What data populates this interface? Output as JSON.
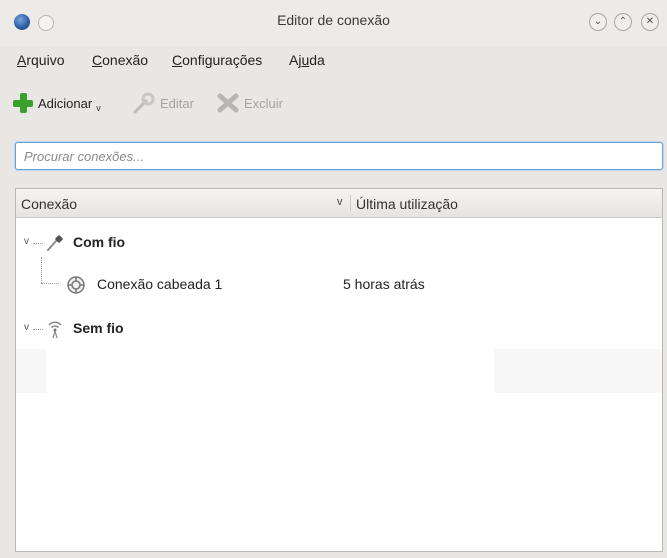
{
  "window": {
    "title": "Editor de conexão"
  },
  "menu": [
    {
      "pre": "",
      "u": "A",
      "post": "rquivo"
    },
    {
      "pre": "",
      "u": "C",
      "post": "onexão"
    },
    {
      "pre": "",
      "u": "C",
      "post": "onfigurações"
    },
    {
      "pre": "Aj",
      "u": "u",
      "post": "da"
    }
  ],
  "toolbar": {
    "add_label": "Adicionar",
    "edit_label": "Editar",
    "delete_label": "Excluir"
  },
  "search": {
    "placeholder": "Procurar conexões..."
  },
  "table": {
    "columns": [
      "Conexão",
      "Última utilização"
    ],
    "groups": [
      {
        "name": "Com fio",
        "items": [
          {
            "name": "Conexão cabeada 1",
            "last_used": "5 horas atrás"
          }
        ]
      },
      {
        "name": "Sem fio",
        "items": []
      }
    ]
  },
  "icons": {
    "app": "kde-globe-icon",
    "add": "plus-icon",
    "edit": "wrench-icon",
    "delete": "x-icon",
    "wired": "ethernet-plug-icon",
    "wireless": "wifi-antenna-icon"
  }
}
